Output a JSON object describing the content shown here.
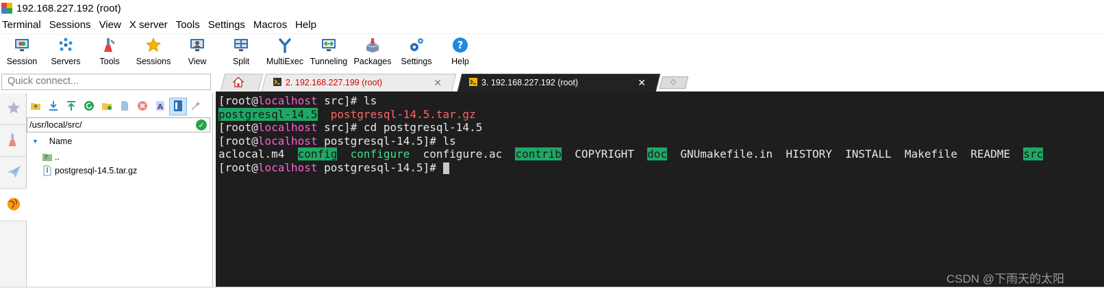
{
  "window": {
    "title": "192.168.227.192 (root)"
  },
  "menu": [
    "Terminal",
    "Sessions",
    "View",
    "X server",
    "Tools",
    "Settings",
    "Macros",
    "Help"
  ],
  "toolbar": [
    {
      "label": "Session",
      "icon": "session-icon"
    },
    {
      "label": "Servers",
      "icon": "servers-icon"
    },
    {
      "label": "Tools",
      "icon": "tools-icon"
    },
    {
      "label": "Sessions",
      "icon": "sessions-star-icon"
    },
    {
      "label": "View",
      "icon": "view-icon"
    },
    {
      "label": "Split",
      "icon": "split-icon"
    },
    {
      "label": "MultiExec",
      "icon": "multiexec-icon"
    },
    {
      "label": "Tunneling",
      "icon": "tunneling-icon"
    },
    {
      "label": "Packages",
      "icon": "packages-icon"
    },
    {
      "label": "Settings",
      "icon": "settings-gears-icon"
    },
    {
      "label": "Help",
      "icon": "help-icon"
    }
  ],
  "quick_connect": {
    "placeholder": "Quick connect..."
  },
  "tabs": [
    {
      "label": "2. 192.168.227.199 (root)",
      "state": "inactive"
    },
    {
      "label": "3. 192.168.227.192 (root)",
      "state": "active"
    }
  ],
  "file_browser": {
    "path": "/usr/local/src/",
    "column_name": "Name",
    "items": [
      {
        "name": "..",
        "type": "parent-folder"
      },
      {
        "name": "postgresql-14.5.tar.gz",
        "type": "file"
      }
    ]
  },
  "terminal": {
    "line1_user": "[root@",
    "line1_host": "localhost",
    "line1_rest": " src]# ls",
    "line2_dir": "postgresql-14.5",
    "line2_arch": "postgresql-14.5.tar.gz",
    "line3_user": "[root@",
    "line3_host": "localhost",
    "line3_rest": " src]# cd postgresql-14.5",
    "line4_user": "[root@",
    "line4_host": "localhost",
    "line4_rest": " postgresql-14.5]# ls",
    "listing": {
      "aclocal": "aclocal.m4",
      "config": "config",
      "configure": "configure",
      "configure_ac": "configure.ac",
      "contrib": "contrib",
      "copyright": "COPYRIGHT",
      "doc": "doc",
      "gnumakefile": "GNUmakefile.in",
      "history": "HISTORY",
      "install": "INSTALL",
      "makefile": "Makefile",
      "readme": "README",
      "src": "src"
    },
    "line6_user": "[root@",
    "line6_host": "localhost",
    "line6_rest": " postgresql-14.5]# "
  },
  "watermark": "CSDN @下雨天的太阳",
  "colors": {
    "terminal_bg": "#1e1e1e",
    "host": "#ff5fd7",
    "dir_bg": "#1fa865",
    "archive": "#ff6464",
    "executable": "#3fdf8f",
    "inactive_tab_text": "#d00000"
  }
}
